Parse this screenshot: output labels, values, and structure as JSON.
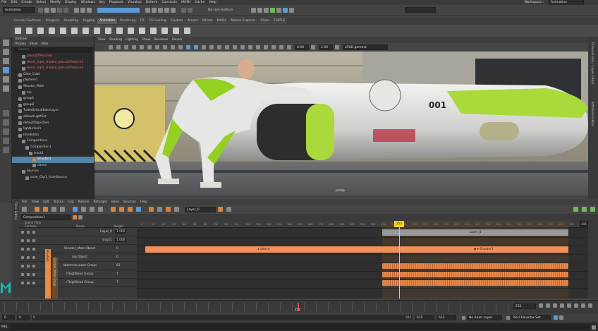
{
  "menubar": {
    "items": [
      "File",
      "Edit",
      "Create",
      "Select",
      "Modify",
      "Display",
      "Windows",
      "Key",
      "Playback",
      "Visualize",
      "Deform",
      "Constrain",
      "MASH",
      "Cache",
      "Help"
    ],
    "workspace_label": "Workspace :",
    "workspace_value": "Animation"
  },
  "statusline": {
    "mode": "Animation",
    "no_live_surface": "No Live Surface"
  },
  "shelf": {
    "tabs": [
      "Curves / Surfaces",
      "Polygons",
      "Sculpting",
      "Rigging",
      "Animation",
      "Rendering",
      "FX",
      "FX Caching",
      "Custom",
      "Arnold",
      "Bifrost",
      "MASH",
      "Motion Graphics",
      "XGen",
      "TURTLE"
    ],
    "active_tab": "Animation"
  },
  "outliner": {
    "title": "Outliner",
    "menu": [
      "Display",
      "Show",
      "Help"
    ],
    "search_placeholder": "Search...",
    "items": [
      {
        "label": "place2dTexture6",
        "indent": 2,
        "state": "red"
      },
      {
        "label": "Hero1_light_shaded_place2dTexture5",
        "indent": 2,
        "state": "red"
      },
      {
        "label": "Hero1_light_shaded_place2dTexture4",
        "indent": 2,
        "state": "red"
      },
      {
        "label": "Glow_Cube",
        "indent": 1,
        "state": ""
      },
      {
        "label": "pSphere1",
        "indent": 1,
        "state": ""
      },
      {
        "label": "Shooter_Male",
        "indent": 1,
        "state": ""
      },
      {
        "label": "hip",
        "indent": 2,
        "state": ""
      },
      {
        "label": "group1",
        "indent": 1,
        "state": ""
      },
      {
        "label": "group8",
        "indent": 1,
        "state": ""
      },
      {
        "label": "TurtleDefaultBakeLayer",
        "indent": 1,
        "state": ""
      },
      {
        "label": "defaultLightSet",
        "indent": 1,
        "state": ""
      },
      {
        "label": "defaultObjectSet",
        "indent": 1,
        "state": ""
      },
      {
        "label": "lightLinker1",
        "indent": 1,
        "state": ""
      },
      {
        "label": "timeEditor",
        "indent": 1,
        "state": ""
      },
      {
        "label": "Compositions",
        "indent": 2,
        "state": ""
      },
      {
        "label": "Composition1",
        "indent": 3,
        "state": ""
      },
      {
        "label": "track1",
        "indent": 4,
        "state": ""
      },
      {
        "label": "Shooter1",
        "indent": 5,
        "state": "sel"
      },
      {
        "label": "dance",
        "indent": 5,
        "state": ""
      },
      {
        "label": "Sources",
        "indent": 2,
        "state": ""
      },
      {
        "label": "anim_Clip1_AnimSource",
        "indent": 3,
        "state": ""
      }
    ]
  },
  "viewport": {
    "menu": [
      "View",
      "Shading",
      "Lighting",
      "Show",
      "Renderer",
      "Panels"
    ],
    "field_a": "0.00",
    "field_b": "1.00",
    "colorspace": "sRGB gamma",
    "camera_label": "persp",
    "ship_number": "001"
  },
  "right_strip": {
    "label_a": "Attribute Editor",
    "label_b": "Channel Box / Layer Editor"
  },
  "time_editor": {
    "side_label": "Time Editor",
    "menu": [
      "File",
      "View",
      "Edit",
      "Tracks",
      "Clip",
      "Retime",
      "Retarget",
      "Bake",
      "Sources",
      "Help"
    ],
    "layer_field": "Layer_0",
    "composition": "Composition1",
    "header_scene_time": "Scene Time",
    "header_controls": "Controls",
    "header_name": "Name",
    "header_weight": "Weight",
    "tracks": [
      {
        "name": "Layer_0",
        "weight": "1.000"
      },
      {
        "name": "track1",
        "weight": "1.000"
      },
      {
        "name": "Shooter_Male Object",
        "weight": "0"
      },
      {
        "name": "hip Object",
        "weight": "6"
      },
      {
        "name": "abdomenLower Group",
        "weight": "82"
      },
      {
        "name": "lThighBend Group",
        "weight": "7"
      },
      {
        "name": "rThighBend Group",
        "weight": "7"
      }
    ],
    "side_tag_a": "Shooter1",
    "side_tag_b": "Shooter_Male Group",
    "current_frame": "252",
    "end_frame": "415",
    "clip_dance": "dance",
    "clip_shooter": "Shooter1",
    "clip_layer": "Layer_0",
    "ruler_ticks": [
      "0",
      "10",
      "20",
      "30",
      "40",
      "50",
      "60",
      "70",
      "80",
      "90",
      "100",
      "110",
      "120",
      "130",
      "140",
      "150",
      "160",
      "170",
      "180",
      "190",
      "200",
      "210",
      "220",
      "230",
      "240",
      "250",
      "260",
      "270",
      "280",
      "290",
      "300",
      "310",
      "320",
      "330",
      "340",
      "350",
      "360",
      "370",
      "380",
      "390",
      "400",
      "410"
    ]
  },
  "timeslider": {
    "current": "252",
    "playhead_value": "252"
  },
  "range": {
    "start": "0",
    "inner_start": "0",
    "inner_end": "415",
    "end": "415",
    "end2": "612",
    "anim_layer": "No Anim Layer",
    "char_set": "No Character Set"
  },
  "cmdline": {
    "lang": "MEL"
  }
}
